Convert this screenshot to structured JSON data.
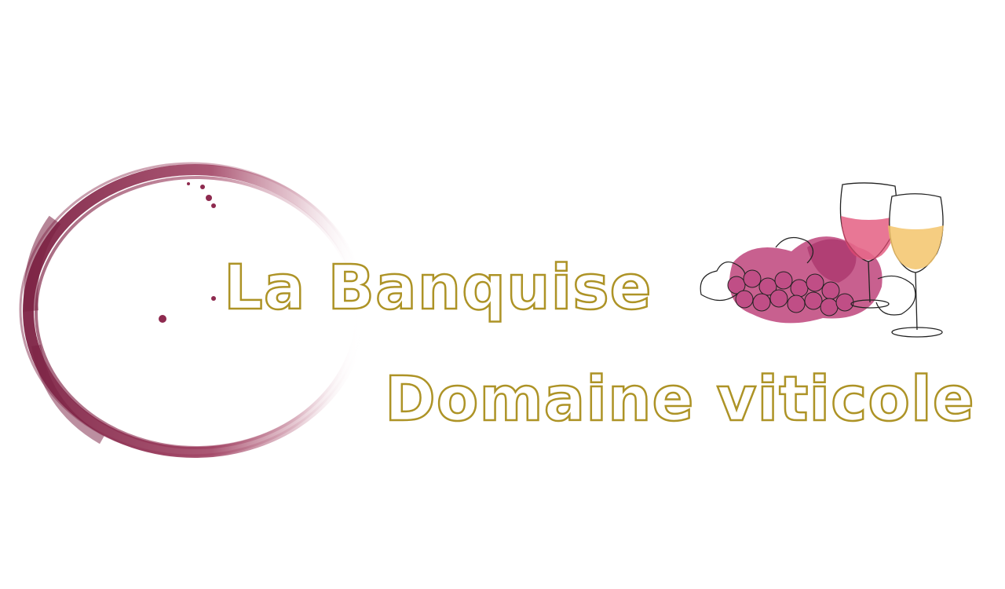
{
  "logo": {
    "line1": "La Banquise",
    "line2": "Domaine viticole"
  },
  "colors": {
    "title_outline": "#ad9326",
    "wine_stain": "#8e2a4f",
    "grape_splash": "#b8336f",
    "white_wine": "#f3c46b",
    "sketch_ink": "#222222"
  },
  "icons": {
    "stain": "wine-ring-stain-icon",
    "illustration": "wine-glasses-grapes-icon"
  }
}
